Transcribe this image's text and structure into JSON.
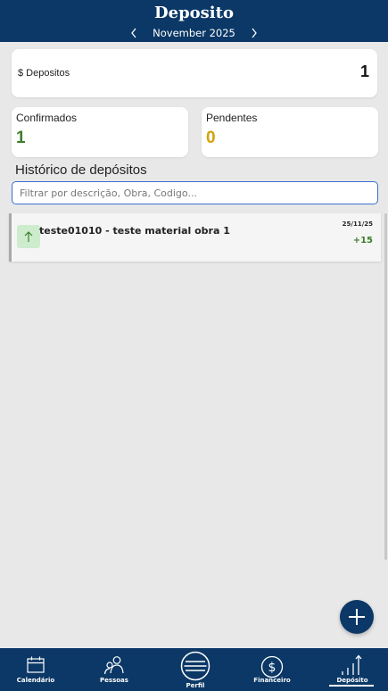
{
  "header": {
    "title": "Deposito",
    "month": "November 2025",
    "prev_icon": "chevron-left",
    "next_icon": "chevron-right"
  },
  "summary": {
    "total_label": "$ Depositos",
    "total_value": "1",
    "confirmed_label": "Confirmados",
    "confirmed_value": "1",
    "pending_label": "Pendentes",
    "pending_value": "0"
  },
  "history": {
    "title": "Histórico de depósitos",
    "filter_placeholder": "Filtrar por descrição, Obra, Codigo...",
    "items": [
      {
        "description": "teste01010 - teste material obra 1",
        "date": "25/11/25",
        "amount": "+15",
        "icon": "arrow-up"
      }
    ]
  },
  "fab": {
    "icon": "plus"
  },
  "nav": {
    "items": [
      {
        "label": "Calendário",
        "icon": "calendar"
      },
      {
        "label": "Pessoas",
        "icon": "people"
      },
      {
        "label": "Perfil",
        "icon": "menu"
      },
      {
        "label": "Financeiro",
        "icon": "dollar"
      },
      {
        "label": "Depósito",
        "icon": "signal-bars"
      }
    ],
    "active": "Depósito"
  },
  "colors": {
    "primary": "#0b3866",
    "confirmed": "#3e7d2c",
    "pending": "#d2a30d",
    "input_border": "#3a6fd0"
  }
}
